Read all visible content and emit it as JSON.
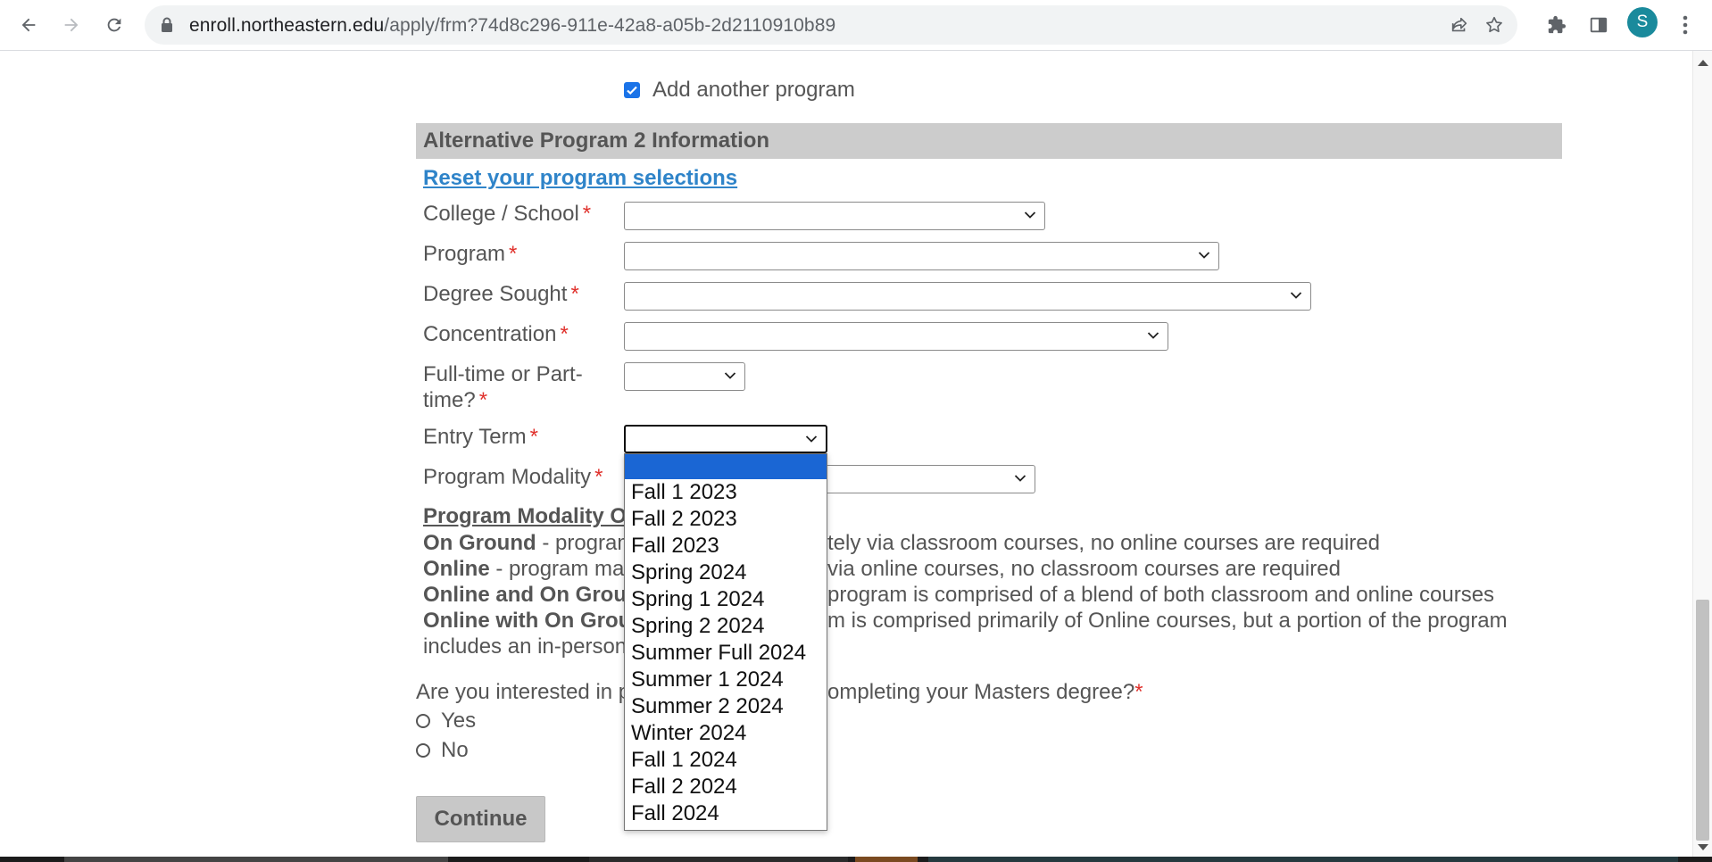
{
  "browser": {
    "url_host": "enroll.northeastern.edu",
    "url_path": "/apply/frm?74d8c296-911e-42a8-a05b-2d2110910b89",
    "profile_initial": "S"
  },
  "form": {
    "add_program_label": "Add another program",
    "add_program_checked": true,
    "section_title": "Alternative Program 2 Information",
    "reset_link": "Reset your program selections",
    "fields": [
      {
        "label": "College / School",
        "required": "*"
      },
      {
        "label": "Program",
        "required": "*"
      },
      {
        "label": "Degree Sought",
        "required": "*"
      },
      {
        "label": "Concentration",
        "required": "*"
      },
      {
        "label": "Full-time or Part-time?",
        "label_line1": "Full-time or Part-",
        "label_line2": "time?",
        "required": "*"
      },
      {
        "label": "Entry Term",
        "required": "*"
      },
      {
        "label": "Program Modality",
        "required": "*"
      }
    ],
    "modality": {
      "title": "Program Modality Op",
      "lines": [
        {
          "bold": "On Ground",
          "left": " - program",
          "right": "tely via classroom courses, no online courses are required"
        },
        {
          "bold": "Online",
          "left": " - program may",
          "right": "via online courses, no classroom courses are required"
        },
        {
          "bold": "Online and On Groun",
          "left": "",
          "right": "program is comprised of a blend of both classroom and online courses"
        },
        {
          "bold": "Online with On Grou",
          "left": "",
          "right": "m is comprised primarily of Online courses, but a portion of the program"
        },
        {
          "bold": "",
          "left": "includes an in-person",
          "right": ""
        }
      ]
    },
    "question": {
      "left": "Are you interested in p",
      "right": "ompleting your Masters degree?",
      "required": "*"
    },
    "radios": [
      "Yes",
      "No"
    ],
    "continue_label": "Continue"
  },
  "entry_term_dropdown": {
    "selected_index": 0,
    "options": [
      "",
      "Fall 1 2023",
      "Fall 2 2023",
      "Fall 2023",
      "Spring 2024",
      "Spring 1 2024",
      "Spring 2 2024",
      "Summer Full 2024",
      "Summer 1 2024",
      "Summer 2 2024",
      "Winter 2024",
      "Fall 1 2024",
      "Fall 2 2024",
      "Fall 2024"
    ]
  },
  "colors": {
    "link": "#2f84c9",
    "required": "#e0312c",
    "header_bg": "#cccccc",
    "selected_option": "#1a66d4",
    "checkbox": "#1a73e8"
  }
}
